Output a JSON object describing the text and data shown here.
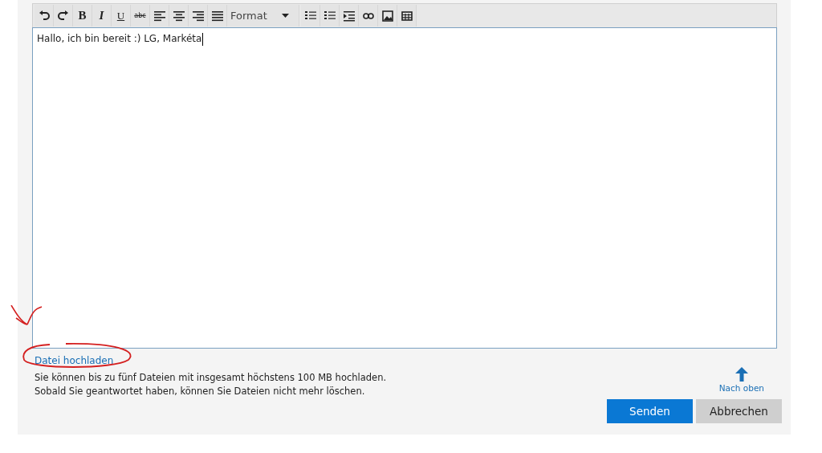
{
  "toolbar": [
    {
      "kind": "undo"
    },
    {
      "kind": "redo"
    },
    {
      "kind": "bold",
      "label": "B"
    },
    {
      "kind": "italic",
      "label": "I"
    },
    {
      "kind": "underline",
      "label": "U"
    },
    {
      "kind": "strike",
      "label": "abc"
    },
    {
      "kind": "align-left"
    },
    {
      "kind": "align-center"
    },
    {
      "kind": "align-right"
    },
    {
      "kind": "justify"
    },
    {
      "kind": "dropdown",
      "label": "Format"
    },
    {
      "kind": "bullets"
    },
    {
      "kind": "numbers"
    },
    {
      "kind": "indent"
    },
    {
      "kind": "link"
    },
    {
      "kind": "image"
    },
    {
      "kind": "table"
    }
  ],
  "editor": {
    "value": "Hallo, ich bin bereit :) LG, Markéta"
  },
  "upload": {
    "link": "Datei hochladen",
    "notes": [
      "Sie können bis zu fünf Dateien mit insgesamt höchstens 100 MB hochladen.",
      "Sobald Sie geantwortet haben, können Sie Dateien nicht mehr löschen."
    ]
  },
  "back_to_top": "Nach oben",
  "buttons": [
    {
      "label": "Senden",
      "kind": "primary"
    },
    {
      "label": "Abbrechen",
      "kind": "secondary"
    }
  ]
}
